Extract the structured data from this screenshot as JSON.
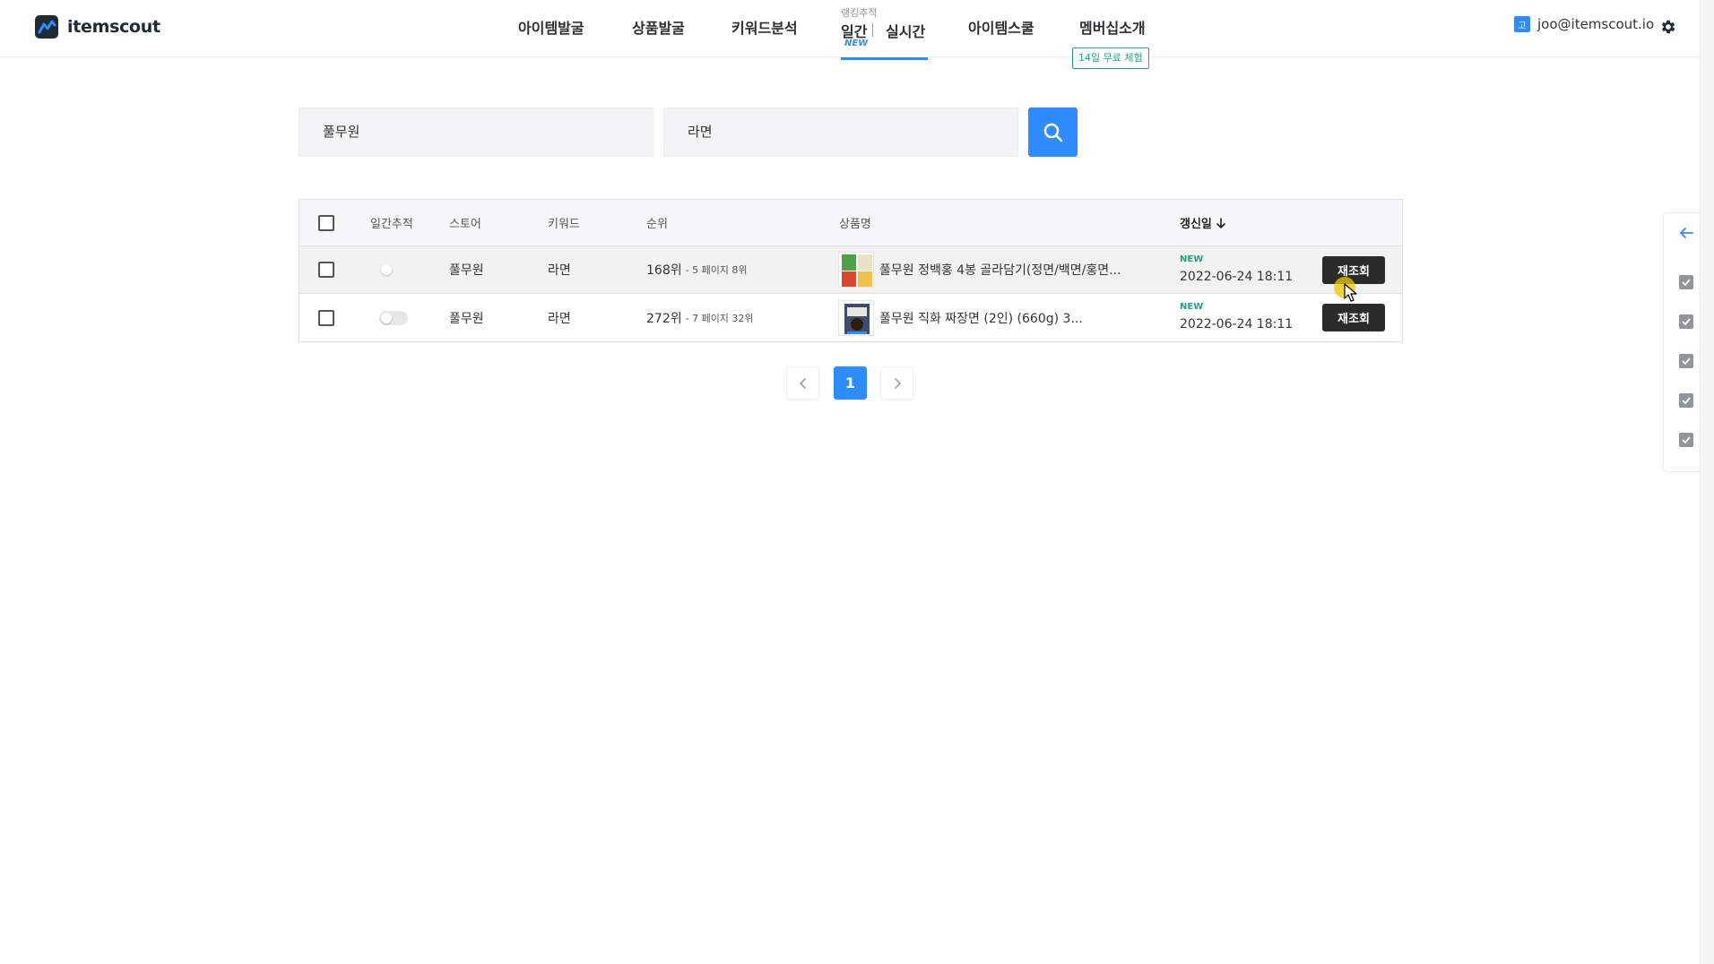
{
  "app": {
    "logo_text": "itemscout"
  },
  "nav": {
    "items": [
      "아이템발굴",
      "상품발굴",
      "키워드분석"
    ],
    "rank_tracking_small": "랭킹추적",
    "daily": "일간",
    "realtime": "실시간",
    "new_badge": "NEW",
    "item_school": "아이템스쿨",
    "membership": "멤버십소개",
    "trial_badge": "14일 무료 체험"
  },
  "user": {
    "badge_letter": "고",
    "email": "joo@itemscout.io"
  },
  "search": {
    "store_value": "풀무원",
    "keyword_value": "라면"
  },
  "table": {
    "headers": {
      "daily_tracking": "일간추적",
      "store": "스토어",
      "keyword": "키워드",
      "rank": "순위",
      "product_name": "상품명",
      "updated": "갱신일"
    },
    "rows": [
      {
        "store": "풀무원",
        "keyword": "라면",
        "rank_main": "168위",
        "rank_sub": "- 5 페이지 8위",
        "product_name": "풀무원 정백홍 4봉 골라담기(정면/백면/홍면...",
        "new_label": "NEW",
        "updated": "2022-06-24 18:11",
        "refresh_label": "재조회"
      },
      {
        "store": "풀무원",
        "keyword": "라면",
        "rank_main": "272위",
        "rank_sub": "- 7 페이지 32위",
        "product_name": "풀무원 직화 짜장면 (2인) (660g) 3...",
        "new_label": "NEW",
        "updated": "2022-06-24 18:11",
        "refresh_label": "재조회"
      }
    ]
  },
  "pagination": {
    "current_page": "1"
  },
  "colors": {
    "accent": "#2f8cff",
    "green": "#21a187",
    "dark_button": "#2b2b2b"
  },
  "icons": [
    "logo-icon",
    "search-icon",
    "gear-icon",
    "sort-down-icon",
    "chevron-left-icon",
    "chevron-right-icon",
    "arrow-left-icon",
    "checkbox-checked-icon"
  ]
}
